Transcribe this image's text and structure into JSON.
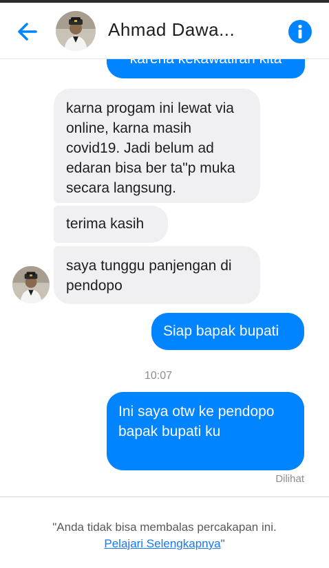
{
  "header": {
    "title": "Ahmad Dawa...",
    "back_icon": "back-arrow-icon",
    "info_icon": "info-icon",
    "accent_color": "#0084ff"
  },
  "messages": {
    "prev_outgoing_fragment": "karena kekawatiran kita",
    "incoming_1": "karna progam ini lewat via online, karna masih covid19. Jadi belum ad edaran bisa ber ta\"p muka secara langsung.",
    "incoming_2": "terima kasih",
    "incoming_3": "saya tunggu panjengan di pendopo",
    "outgoing_1": "Siap bapak bupati",
    "timestamp": "10:07",
    "outgoing_2": "Ini saya otw  ke pendopo bapak bupati ku",
    "seen_status": "Dilihat"
  },
  "footer": {
    "notice_prefix": "\"Anda tidak bisa membalas percakapan ini.",
    "learn_more": "Pelajari Selengkapnya",
    "notice_suffix": "\""
  }
}
